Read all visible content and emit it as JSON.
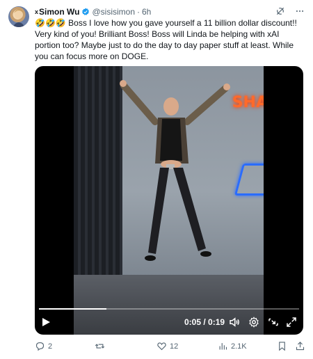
{
  "post": {
    "author_name": "Simon Wu",
    "author_badge": "x",
    "handle": "@sisisimon",
    "separator": "·",
    "time": "6h",
    "text": "🤣🤣🤣 Boss I love how you gave yourself a 11 billion dollar discount!! Very kind of you!  Brilliant Boss!  Boss will Linda be helping with xAI portion too?  Maybe just to do the day to day paper stuff at least.  While you can focus more on DOGE.",
    "icons": {
      "grok": "grok-icon",
      "more": "more-icon",
      "verified": "verified-badge-icon"
    },
    "colors": {
      "verified": "#1d9bf0",
      "muted": "#536471",
      "text": "#0f1419"
    }
  },
  "video": {
    "time_readout": "0:05 / 0:19",
    "progress": 0.26,
    "neon_text": "SHA",
    "icons": [
      "play-icon",
      "volume-icon",
      "settings-icon",
      "pip-icon",
      "fullscreen-icon"
    ]
  },
  "actions": {
    "replies": "2",
    "reposts": "",
    "likes": "12",
    "views": "2.1K"
  }
}
